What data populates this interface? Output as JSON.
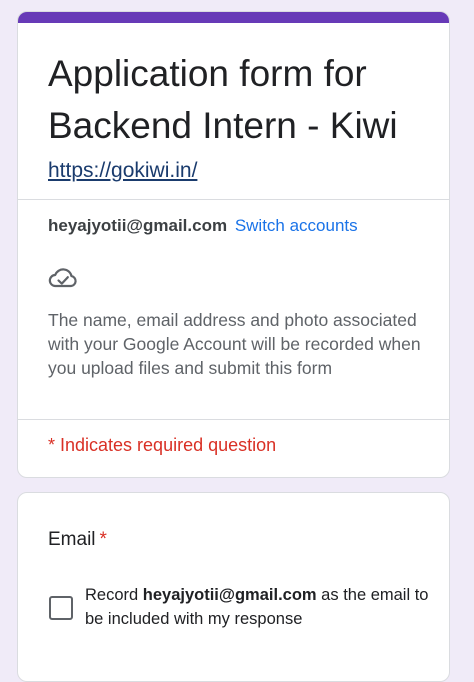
{
  "theme": {
    "accent": "#673ab7",
    "background": "#f0ebf8",
    "required_color": "#d93025",
    "link_color": "#1a73e8"
  },
  "header": {
    "title": "Application form for Backend Intern - Kiwi",
    "link": "https://gokiwi.in/",
    "account_email": "heyajyotii@gmail.com",
    "switch_accounts": "Switch accounts",
    "cloud_icon": "cloud-done-icon",
    "disclaimer": "The name, email address and photo associated with your Google Account will be recorded when you upload files and submit this form",
    "required_note": "* Indicates required question"
  },
  "email_question": {
    "title": "Email",
    "required_mark": "*",
    "checkbox_checked": false,
    "record_prefix": "Record ",
    "record_email": "heyajyotii@gmail.com",
    "record_suffix": " as the email to be included with my response"
  }
}
